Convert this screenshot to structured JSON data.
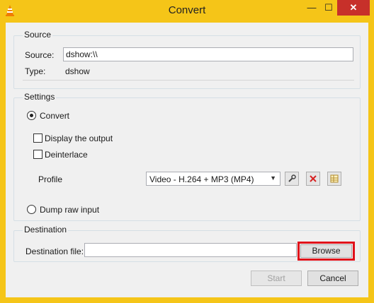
{
  "window": {
    "title": "Convert",
    "minimize_glyph": "—",
    "maximize_glyph": "☐",
    "close_glyph": "✕",
    "app_icon": "vlc-cone-icon",
    "accent_color": "#f5c518"
  },
  "source": {
    "group_label": "Source",
    "source_label": "Source:",
    "source_value": "dshow:\\\\",
    "type_label": "Type:",
    "type_value": "dshow"
  },
  "settings": {
    "group_label": "Settings",
    "convert_label": "Convert",
    "convert_selected": true,
    "display_output_label": "Display the output",
    "deinterlace_label": "Deinterlace",
    "profile_label": "Profile",
    "profile_value": "Video - H.264 + MP3 (MP4)",
    "dump_raw_label": "Dump raw input"
  },
  "destination": {
    "group_label": "Destination",
    "file_label": "Destination file:",
    "file_value": "",
    "browse_label": "Browse"
  },
  "footer": {
    "start_label": "Start",
    "cancel_label": "Cancel"
  }
}
